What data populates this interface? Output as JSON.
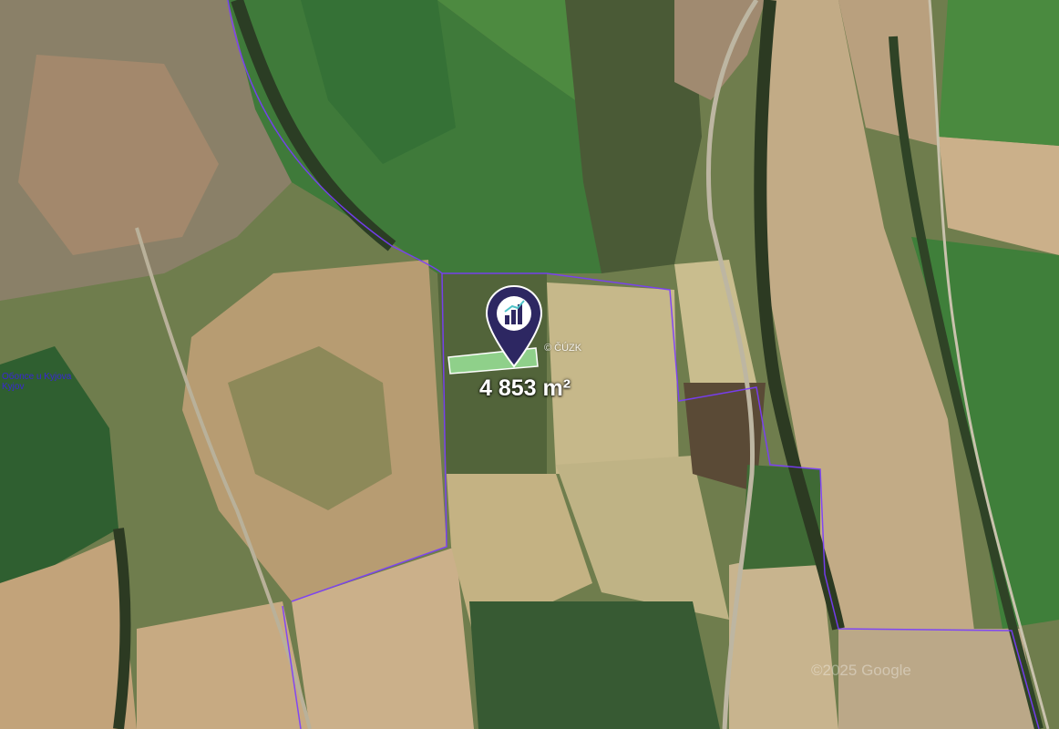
{
  "map": {
    "area_label": "4 853 m²",
    "watermark": "© ČÚZK",
    "copyright": "©2025 Google",
    "road_label_line1": "Обоnce u Kyjova",
    "road_label_line2": "Kyjov",
    "marker_icon": "property-chart-pin-icon",
    "colors": {
      "marker": "#2d2762",
      "parcel_outline": "#7a3cff",
      "highlight_strip": "#8fd08a"
    }
  }
}
